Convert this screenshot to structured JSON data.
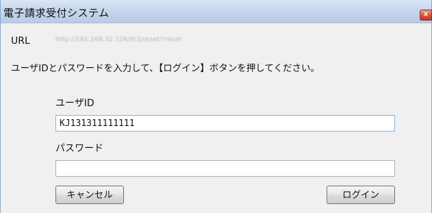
{
  "window": {
    "title": "電子請求受付システム",
    "close_label": "x"
  },
  "url": {
    "label": "URL",
    "value": "http://192.168.32.126/9/3/reset/?reset"
  },
  "instruction": "ユーザIDとパスワードを入力して、【ログイン】ボタンを押してください。",
  "form": {
    "userid_label": "ユーザID",
    "userid_value": "KJ131311111111",
    "password_label": "パスワード",
    "password_value": ""
  },
  "buttons": {
    "cancel_label": "キャンセル",
    "login_label": "ログイン"
  },
  "colors": {
    "titlebar": "#c6d6ec",
    "close_button": "#c0392b",
    "focus_border": "#7eb4ea"
  }
}
